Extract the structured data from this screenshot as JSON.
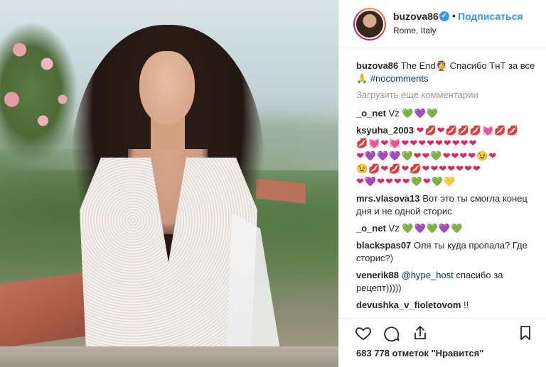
{
  "post": {
    "username": "buzova86",
    "follow_label": "Подписаться",
    "dot": "•",
    "location": "Rome, Italy",
    "verified_mark": "✓"
  },
  "caption": {
    "username": "buzova86",
    "text": "The End👰 Спасибо ТнТ за все 🙏",
    "hashtag": "#nocomments"
  },
  "load_more": "Загрузить еще комментарии",
  "comments": [
    {
      "user": "_o_net",
      "text": "Vz"
    },
    {
      "user": "ksyuha_2003",
      "text": ""
    },
    {
      "user": "mrs.vlasova13",
      "text": "Вот это ты смогла конец дня и не одной сторис"
    },
    {
      "user": "_o_net",
      "text": "Vz"
    },
    {
      "user": "blackspas07",
      "text": "Оля ты куда пропала? Где сторис?)"
    },
    {
      "user": "venerik88",
      "mention": "@hype_host",
      "text": "спасибо за рецепт)))))"
    },
    {
      "user": "devushka_v_fioletovom",
      "text": "!!"
    }
  ],
  "emoji": {
    "c1": "💚💜💚",
    "c2a": "❤💋❤💋💋💋💓💋💋",
    "c2b": "💋💓❤💓❤❤❤❤❤❤❤❤❤",
    "c2c": "❤💜💜💜💚❤❤💚❤❤❤❤😉❤",
    "c2d": "😉💋❤💋❤💋❤❤❤❤❤❤❤",
    "c2e": "❤💜❤❤❤❤💚❤💚💛",
    "c4": "💚💜💚💜💚"
  },
  "likes": "683 778 отметок \"Нравится\"",
  "icons": [
    "heart-icon",
    "comment-icon",
    "share-icon",
    "bookmark-icon"
  ]
}
